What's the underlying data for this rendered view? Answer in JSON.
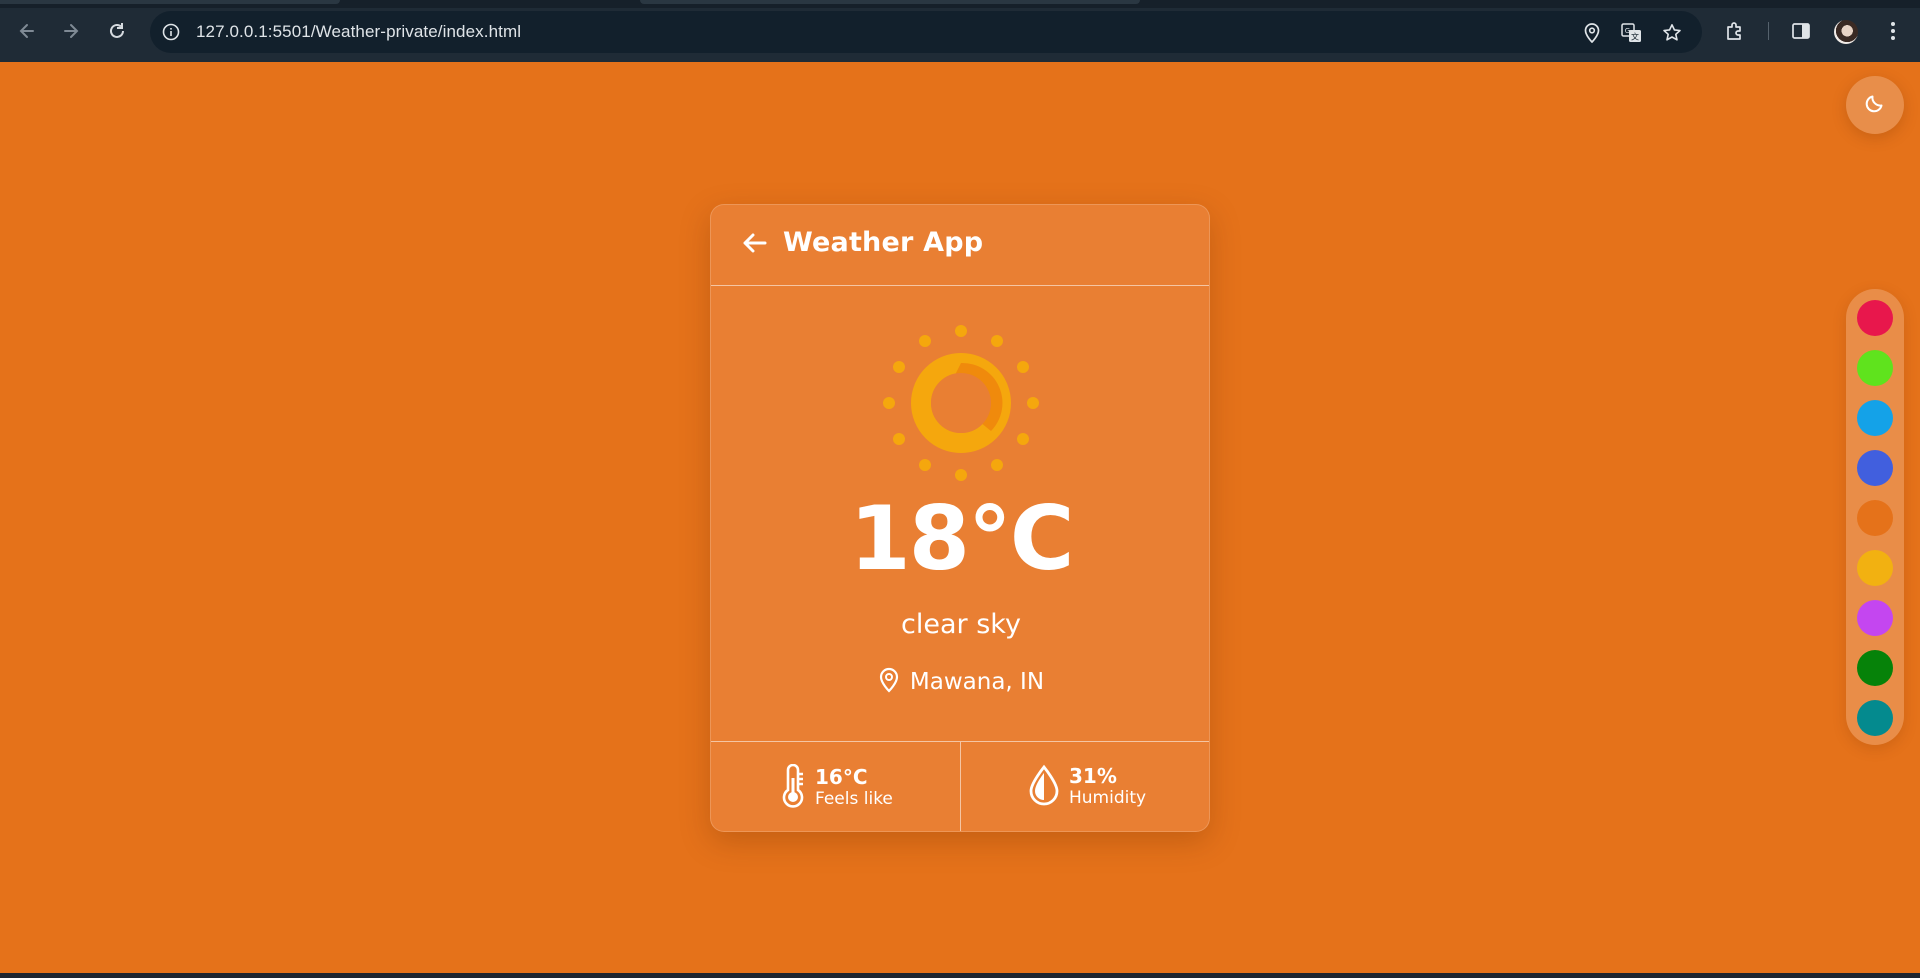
{
  "browser": {
    "url": "127.0.0.1:5501/Weather-private/index.html",
    "icons": [
      "back-icon",
      "forward-icon",
      "reload-icon",
      "site-info-icon",
      "location-icon",
      "translate-icon",
      "bookmark-star-icon",
      "extensions-icon",
      "side-panel-icon",
      "profile-avatar",
      "menu-kebab-icon"
    ]
  },
  "app": {
    "title": "Weather App",
    "temperature": "18°C",
    "description": "clear sky",
    "location": "Mawana, IN",
    "feels_like": {
      "value": "16°C",
      "label": "Feels like"
    },
    "humidity": {
      "value": "31%",
      "label": "Humidity"
    }
  },
  "theme": {
    "background": "#e5721a",
    "card": "#e97f33",
    "swatches": [
      "#e8174c",
      "#5fe31d",
      "#14a2e8",
      "#415fde",
      "#e5721a",
      "#f2b111",
      "#c446f0",
      "#068209",
      "#048a8e"
    ]
  }
}
